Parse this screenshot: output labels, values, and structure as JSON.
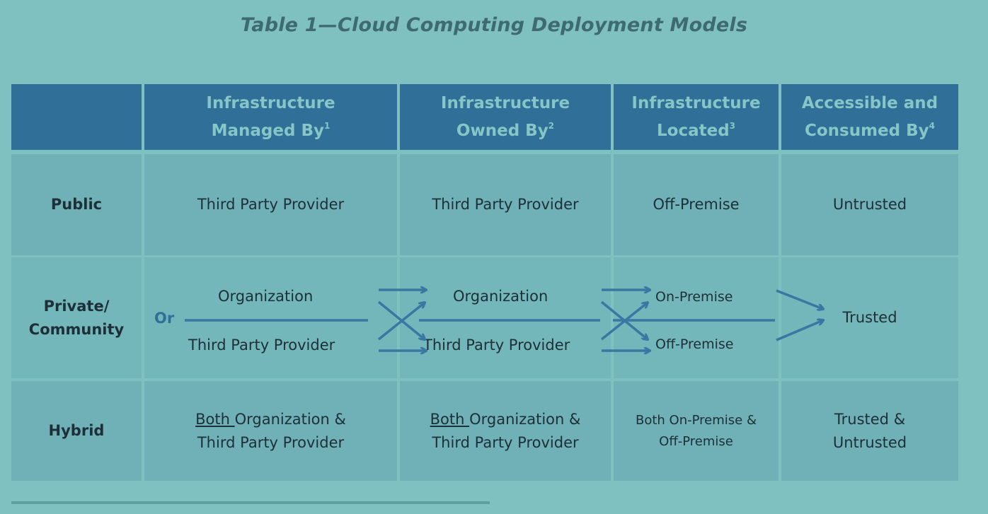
{
  "title": "Table 1—Cloud Computing Deployment Models",
  "colors": {
    "background": "#7fc1c0",
    "header_bg": "#2f6f98",
    "header_text": "#86c6c6",
    "row_bg": "#6fb1b6",
    "arrow": "#3a77a3",
    "or_text": "#2f6f98"
  },
  "table": {
    "headers": [
      {
        "text": "",
        "sup": ""
      },
      {
        "line1": "Infrastructure",
        "line2": "Managed By",
        "sup": "1"
      },
      {
        "line1": "Infrastructure",
        "line2": "Owned By",
        "sup": "2"
      },
      {
        "line1": "Infrastructure",
        "line2": "Located",
        "sup": "3"
      },
      {
        "line1": "Accessible and",
        "line2": "Consumed By",
        "sup": "4"
      }
    ],
    "rows": [
      {
        "label": "Public",
        "managed_by": "Third Party Provider",
        "owned_by": "Third Party Provider",
        "located": "Off-Premise",
        "consumed_by": "Untrusted"
      },
      {
        "label_line1": "Private/",
        "label_line2": "Community",
        "or_label": "Or",
        "managed_by_top": "Organization",
        "managed_by_bottom": "Third Party Provider",
        "owned_by_top": "Organization",
        "owned_by_bottom": "Third Party Provider",
        "located_top": "On-Premise",
        "located_bottom": "Off-Premise",
        "consumed_by": "Trusted"
      },
      {
        "label": "Hybrid",
        "managed_by_underlined": "Both ",
        "managed_by_line1_rest": "Organization &",
        "managed_by_line2": "Third Party Provider",
        "owned_by_underlined": "Both ",
        "owned_by_line1_rest": "Organization &",
        "owned_by_line2": "Third Party Provider",
        "located_line1": "Both On-Premise &",
        "located_line2": "Off-Premise",
        "consumed_by_line1": "Trusted &",
        "consumed_by_line2": "Untrusted"
      }
    ]
  }
}
